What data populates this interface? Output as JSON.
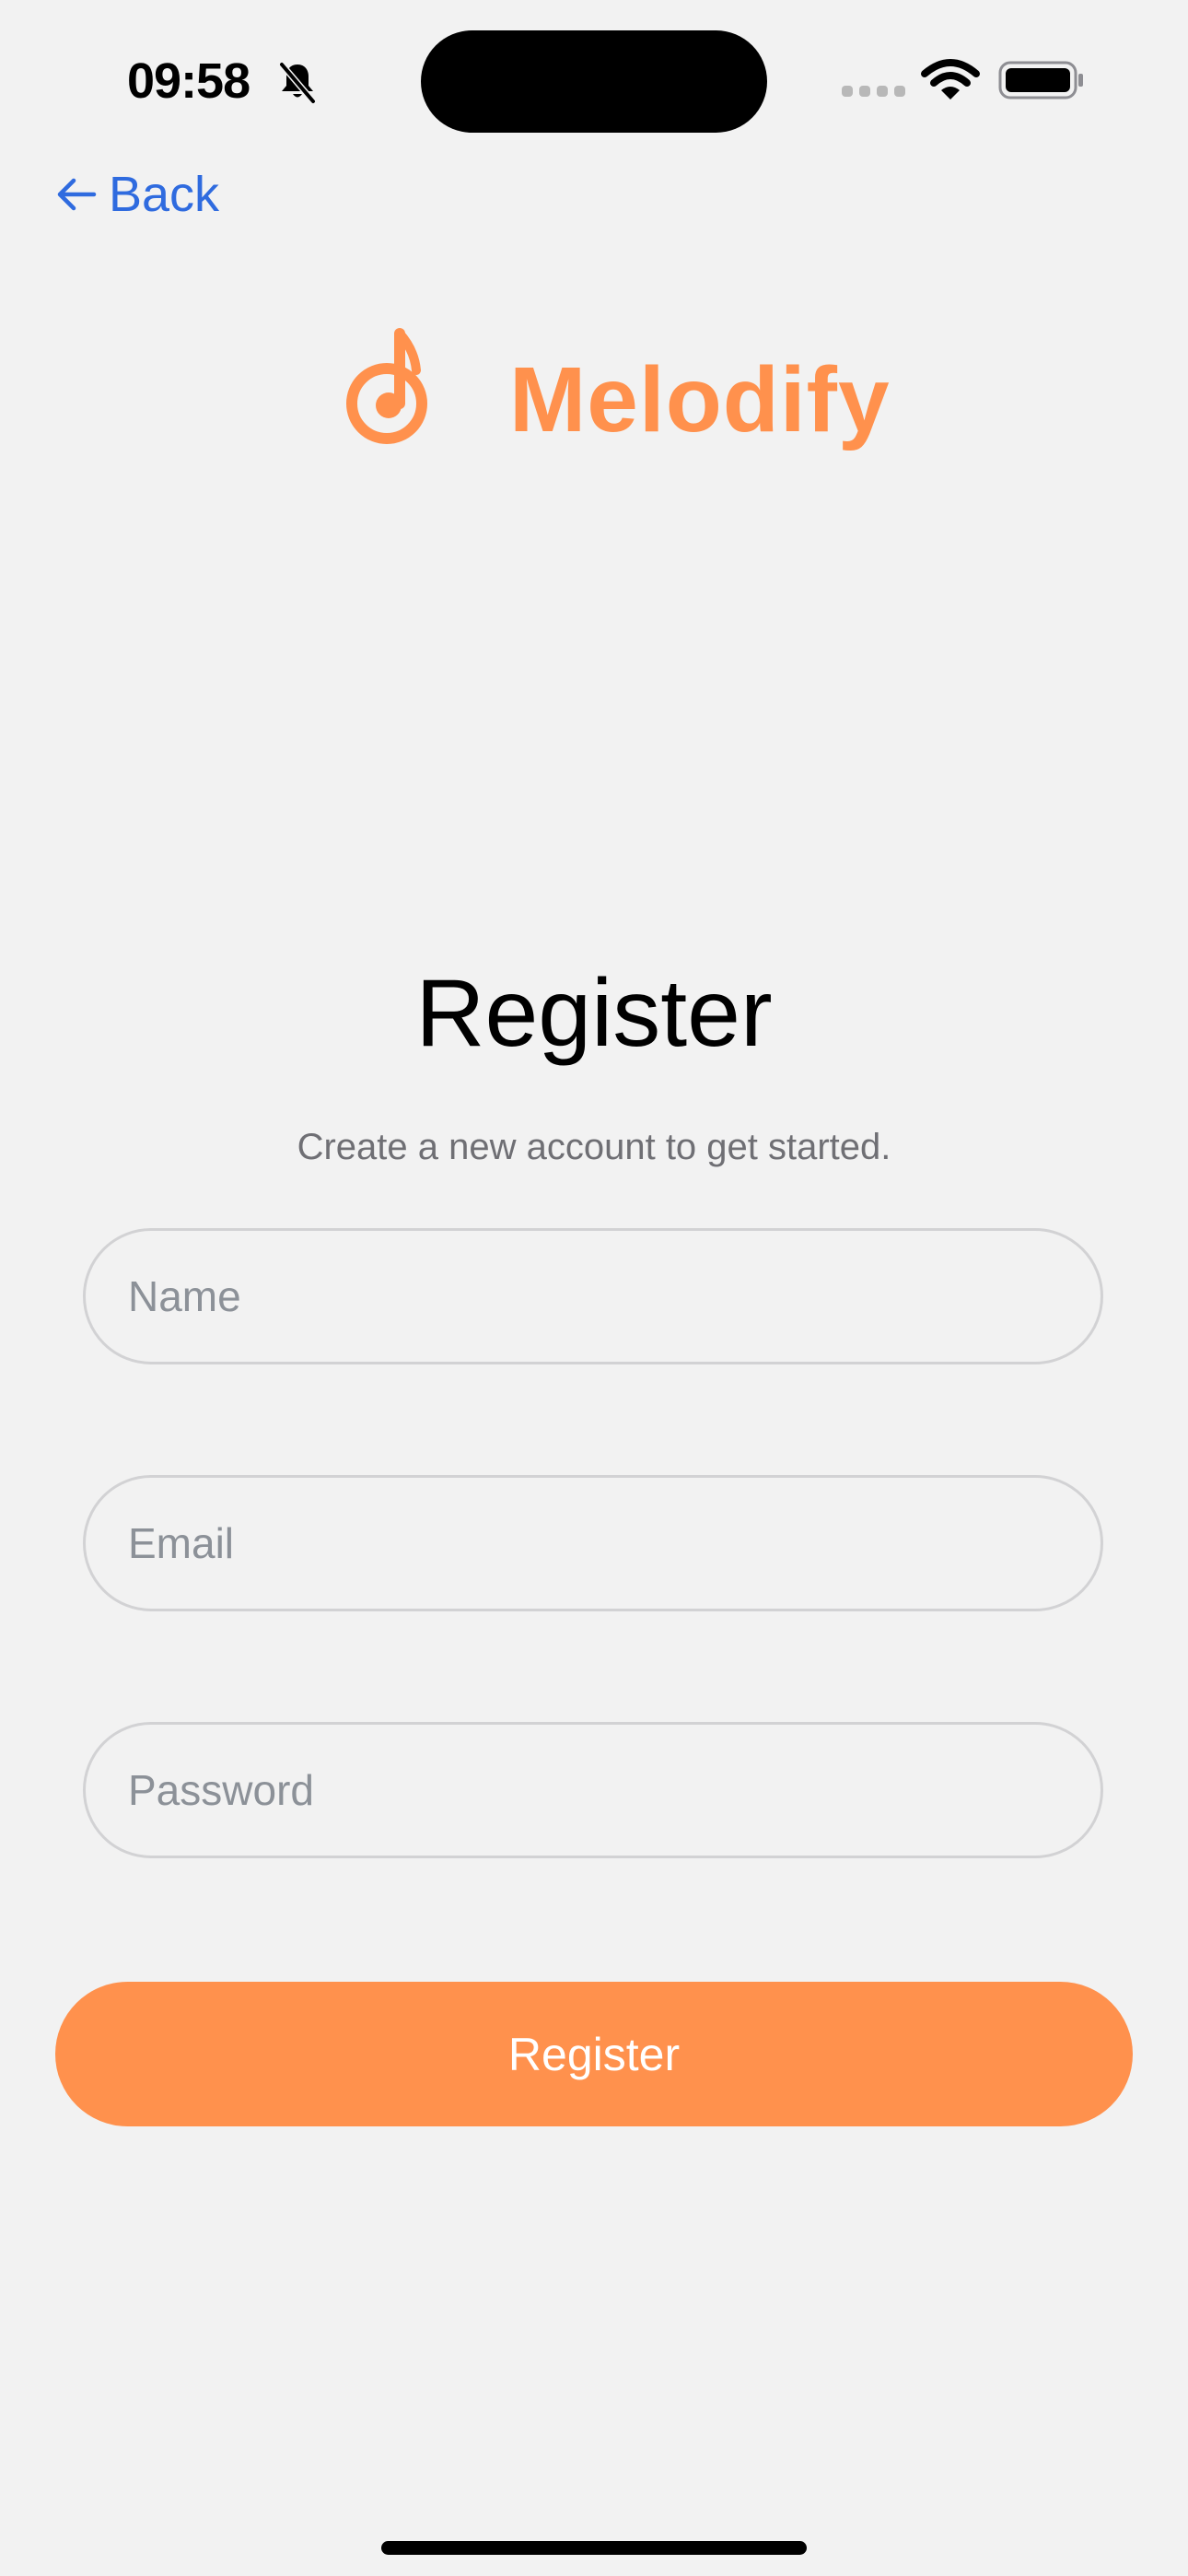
{
  "status_bar": {
    "time": "09:58",
    "icons": [
      "bell-slash-icon",
      "cellular-signal-icon",
      "wifi-icon",
      "battery-icon"
    ]
  },
  "nav": {
    "back_label": "Back",
    "back_icon": "arrow-left-icon"
  },
  "logo": {
    "name": "Melodify",
    "icon": "music-note-icon",
    "color": "#ff914d"
  },
  "main": {
    "title": "Register",
    "subtitle": "Create a new account to get started.",
    "fields": {
      "name": {
        "placeholder": "Name",
        "value": ""
      },
      "email": {
        "placeholder": "Email",
        "value": ""
      },
      "password": {
        "placeholder": "Password",
        "value": ""
      }
    },
    "submit_label": "Register"
  },
  "colors": {
    "accent": "#ff914d",
    "link": "#2f6bdf",
    "background": "#f2f2f2"
  }
}
